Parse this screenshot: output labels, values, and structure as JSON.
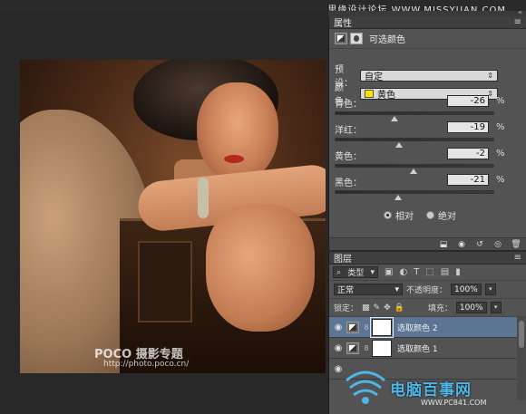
{
  "watermark_top": "思缘设计论坛 WWW.MISSYUAN.COM",
  "photo": {
    "watermark_brand": "POCO 摄影专题",
    "watermark_url": "http://photo.poco.cn/"
  },
  "properties": {
    "title": "属性",
    "adjustment_label": "可选颜色",
    "preset_label": "预设：",
    "preset_value": "自定",
    "colors_label": "颜色：",
    "colors_value": "黄色",
    "colors_swatch": "#ffe600",
    "sliders": [
      {
        "label": "青色：",
        "value": "-26",
        "unit": "%",
        "level": 0.37
      },
      {
        "label": "洋红：",
        "value": "-19",
        "unit": "%",
        "level": 0.4
      },
      {
        "label": "黄色：",
        "value": "-2",
        "unit": "%",
        "level": 0.49
      },
      {
        "label": "黑色：",
        "value": "-21",
        "unit": "%",
        "level": 0.39
      }
    ],
    "method_relative": "相对",
    "method_absolute": "绝对",
    "method_selected": "relative"
  },
  "layers": {
    "title": "图层",
    "kind_filter": "类型",
    "blend_mode": "正常",
    "opacity_label": "不透明度：",
    "opacity_value": "100%",
    "lock_label": "锁定：",
    "fill_label": "填充：",
    "fill_value": "100%",
    "items": [
      {
        "name": "选取颜色 2",
        "selected": true
      },
      {
        "name": "选取颜色 1",
        "selected": false
      }
    ]
  },
  "watermark_site": {
    "name": "电脑百事网",
    "url": "WWW.PC841.COM"
  }
}
